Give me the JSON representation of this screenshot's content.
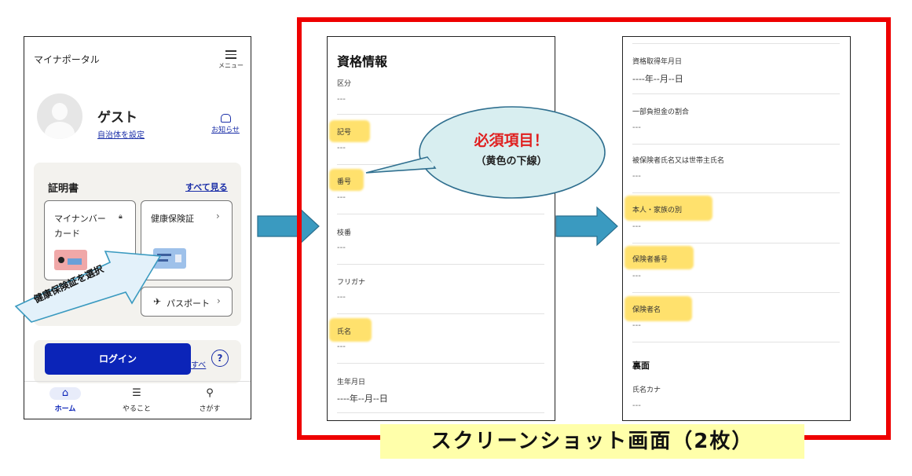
{
  "phone1": {
    "app_title": "マイナポータル",
    "menu_label": "メニュー",
    "menu_icon": "hamburger-icon",
    "user_name": "ゲスト",
    "set_municipality": "自治体を設定",
    "notice_label": "お知らせ",
    "notice_icon": "mailbox-icon",
    "cert_section_title": "証明書",
    "see_all": "すべて見る",
    "cards": [
      {
        "label": "マイナンバーカード",
        "line1": "マイナンバー",
        "line2": "カード",
        "icon": "lock-icon"
      },
      {
        "label": "健康保険証",
        "icon": "chevron-right-icon"
      }
    ],
    "passport_label": "パスポート",
    "login_button": "ログイン",
    "login_other_partial": "すべ",
    "help_glyph": "?",
    "tabs": [
      {
        "label": "ホーム",
        "icon": "home-icon",
        "active": true
      },
      {
        "label": "やること",
        "icon": "clipboard-icon",
        "active": false
      },
      {
        "label": "さがす",
        "icon": "search-icon",
        "active": false
      }
    ]
  },
  "callout_select": "健康保険証を選択",
  "bubble": {
    "main": "必須項目！",
    "sub": "（黄色の下線）",
    "main_color": "#e02020"
  },
  "phone2": {
    "title": "資格情報",
    "fields": [
      {
        "label": "区分",
        "value": "---",
        "highlight": false
      },
      {
        "label": "記号",
        "value": "---",
        "highlight": true
      },
      {
        "label": "番号",
        "value": "---",
        "highlight": true
      },
      {
        "label": "枝番",
        "value": "---",
        "highlight": false
      },
      {
        "label": "フリガナ",
        "value": "---",
        "highlight": false
      },
      {
        "label": "氏名",
        "value": "---",
        "highlight": true
      },
      {
        "label": "生年月日",
        "value": "----年--月--日",
        "highlight": false
      }
    ]
  },
  "phone3": {
    "fields": [
      {
        "label": "資格取得年月日",
        "value": "----年--月--日",
        "highlight": false
      },
      {
        "label": "一部負担金の割合",
        "value": "---",
        "highlight": false
      },
      {
        "label": "被保険者氏名又は世帯主氏名",
        "value": "---",
        "highlight": false
      },
      {
        "label": "本人・家族の別",
        "value": "---",
        "highlight": true
      },
      {
        "label": "保険者番号",
        "value": "---",
        "highlight": true
      },
      {
        "label": "保険者名",
        "value": "---",
        "highlight": true
      }
    ],
    "section_back": "裏面",
    "kana_label": "氏名カナ",
    "kana_value": "---"
  },
  "screenshot_caption": "スクリーンショット画面（2枚）",
  "colors": {
    "frame_red": "#ee0000",
    "highlight_yellow": "#ffd73c",
    "arrow_blue": "#3a9ac0",
    "login_blue": "#0b24b8",
    "caption_bg": "#ffffaa"
  }
}
